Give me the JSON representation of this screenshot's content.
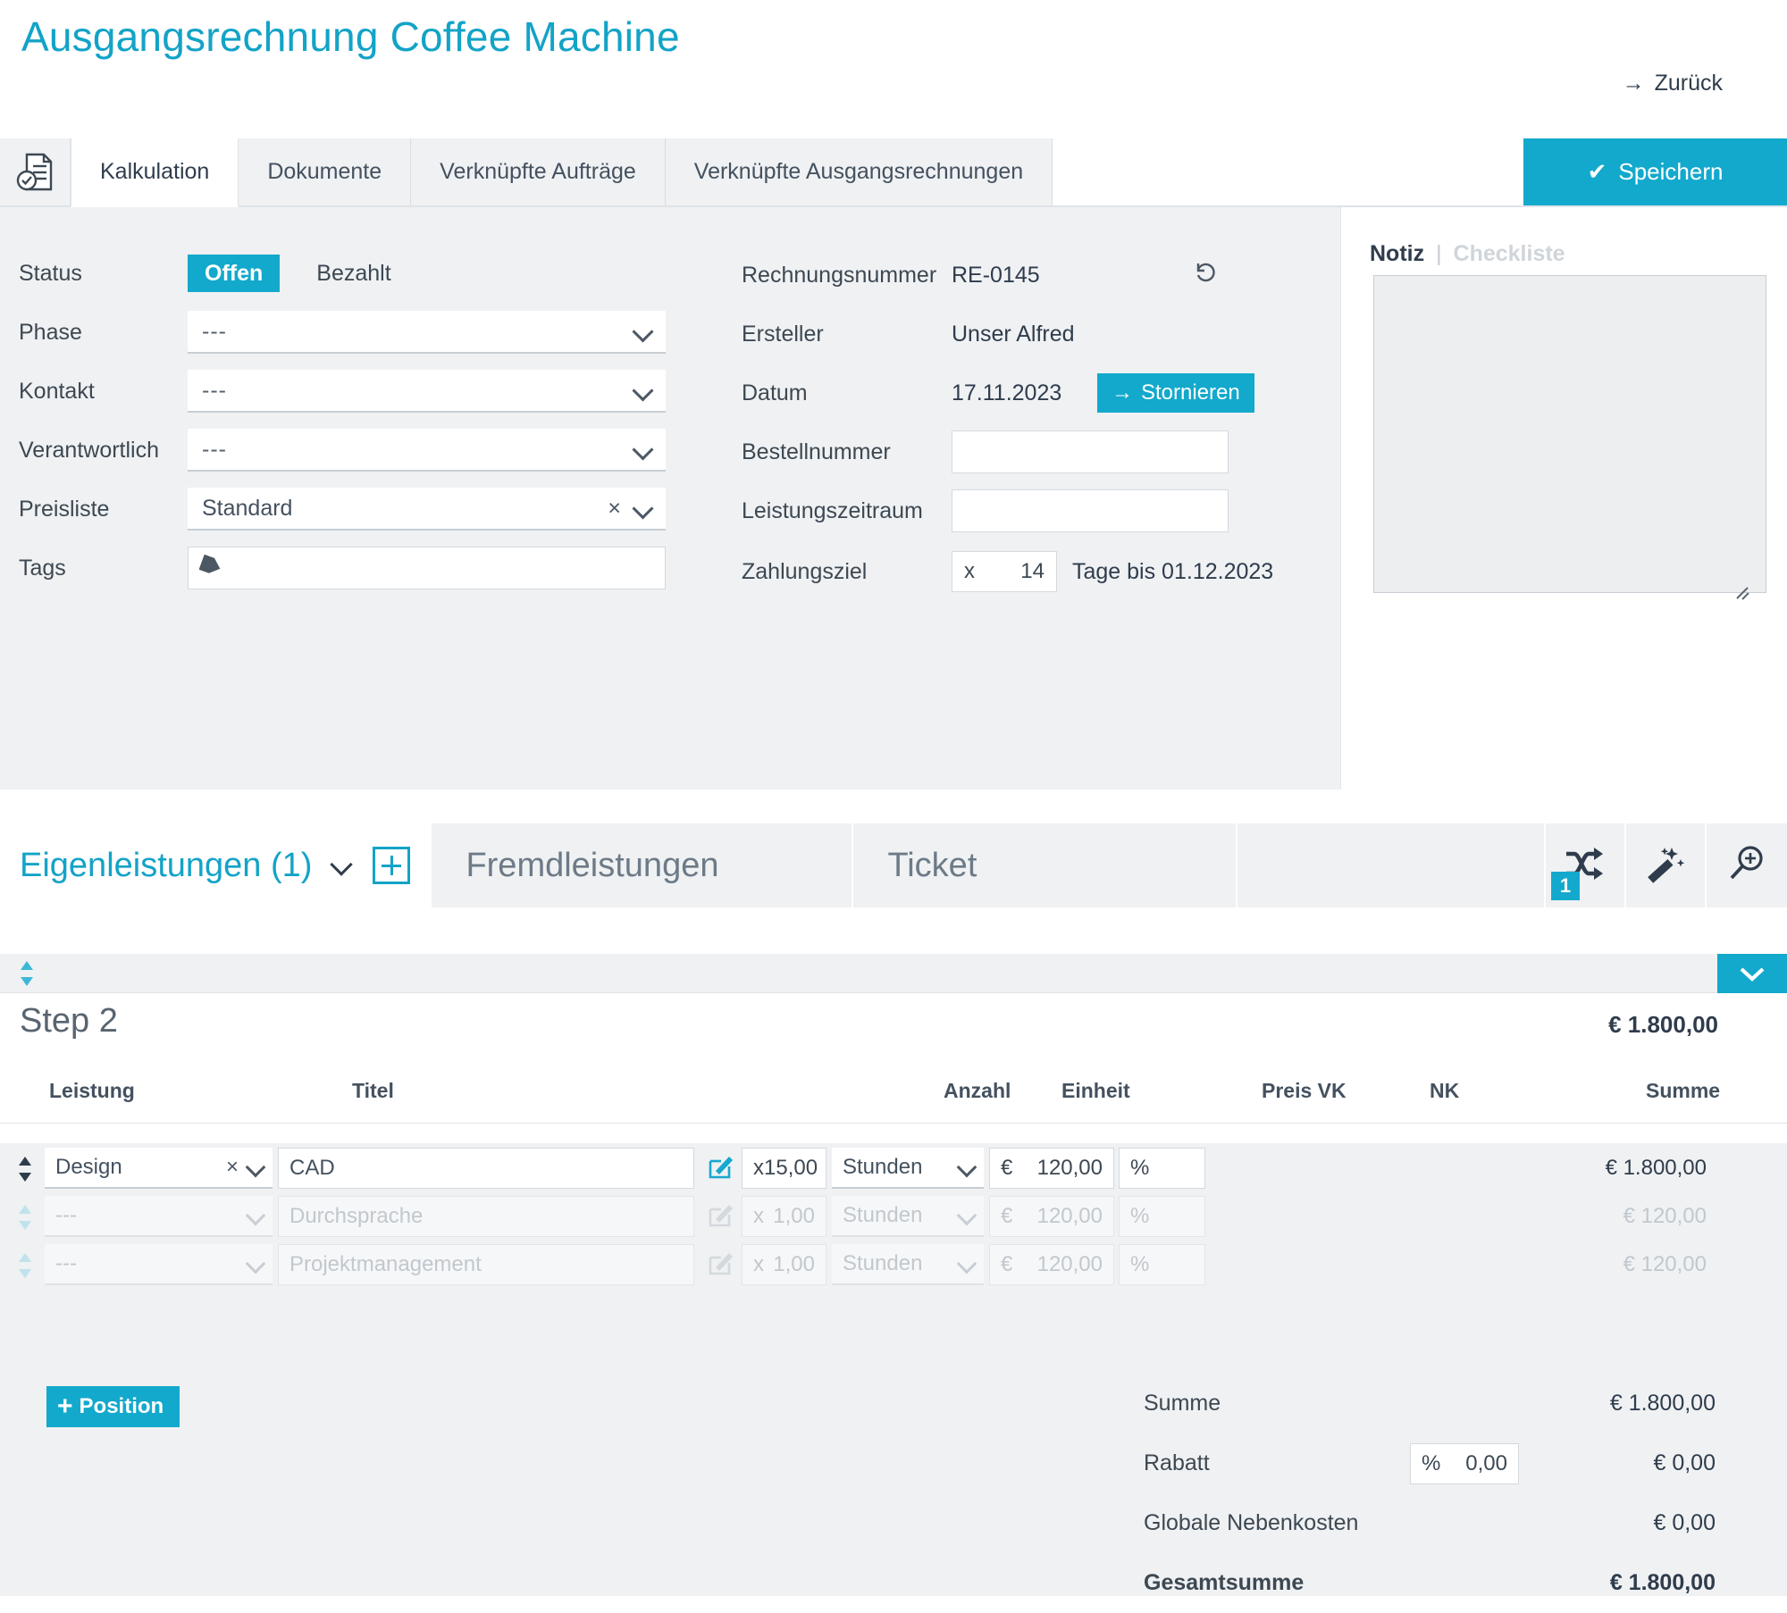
{
  "header": {
    "title": "Ausgangsrechnung Coffee Machine",
    "back_label": "Zurück",
    "back_arrow": "→",
    "save_label": "Speichern",
    "save_check": "✔"
  },
  "tabs": {
    "doc_icon": "document-check-icon",
    "items": [
      {
        "label": "Kalkulation",
        "active": true
      },
      {
        "label": "Dokumente",
        "active": false
      },
      {
        "label": "Verknüpfte Aufträge",
        "active": false
      },
      {
        "label": "Verknüpfte Ausgangsrechnungen",
        "active": false
      }
    ]
  },
  "form": {
    "left": {
      "status_label": "Status",
      "status_open": "Offen",
      "status_paid": "Bezahlt",
      "phase_label": "Phase",
      "phase_value": "---",
      "kontakt_label": "Kontakt",
      "kontakt_value": "---",
      "verantwortlich_label": "Verantwortlich",
      "verantwortlich_value": "---",
      "preisliste_label": "Preisliste",
      "preisliste_value": "Standard",
      "preisliste_clear": "×",
      "tags_label": "Tags",
      "tags_value": "",
      "tag_icon": "tag-icon"
    },
    "right": {
      "rechnungsnummer_label": "Rechnungsnummer",
      "rechnungsnummer_value": "RE-0145",
      "undo_icon": "↺",
      "ersteller_label": "Ersteller",
      "ersteller_value": "Unser Alfred",
      "datum_label": "Datum",
      "datum_value": "17.11.2023",
      "storno_label": "Stornieren",
      "storno_arrow": "→",
      "bestellnummer_label": "Bestellnummer",
      "bestellnummer_value": "",
      "leistungszeitraum_label": "Leistungszeitraum",
      "leistungszeitraum_value": "",
      "zahlungsziel_label": "Zahlungsziel",
      "zahlungsziel_prefix": "x",
      "zahlungsziel_days": "14",
      "zahlungsziel_suffix": "Tage bis 01.12.2023"
    }
  },
  "notiz": {
    "tab_notiz": "Notiz",
    "separator": "|",
    "tab_checkliste": "Checkliste",
    "text": ""
  },
  "section_tabs": {
    "active_label": "Eigenleistungen (1)",
    "add_icon": "plus-box-icon",
    "chevron_icon": "chevron-down-icon",
    "items": [
      {
        "label": "Fremdleistungen"
      },
      {
        "label": "Ticket"
      }
    ],
    "tool_shuffle": "shuffle-icon",
    "tool_shuffle_badge": "1",
    "tool_wand": "magic-wand-icon",
    "tool_zoom": "zoom-in-icon"
  },
  "table": {
    "step_title": "Step 2",
    "step_total": "€ 1.800,00",
    "columns": [
      "Leistung",
      "Titel",
      "Anzahl",
      "Einheit",
      "Preis VK",
      "NK",
      "Summe"
    ],
    "rows": [
      {
        "leistung": "Design",
        "clear": "×",
        "titel": "CAD",
        "edit_icon": "edit-pencil-icon",
        "anzahl_prefix": "x",
        "anzahl": "15,00",
        "einheit": "Stunden",
        "preis_prefix": "€",
        "preis": "120,00",
        "nk_prefix": "%",
        "nk": "",
        "summe": "€ 1.800,00",
        "ghost": false
      },
      {
        "leistung": "---",
        "clear": "",
        "titel": "Durchsprache",
        "edit_icon": "edit-pencil-icon",
        "anzahl_prefix": "x",
        "anzahl": "1,00",
        "einheit": "Stunden",
        "preis_prefix": "€",
        "preis": "120,00",
        "nk_prefix": "%",
        "nk": "",
        "summe": "€ 120,00",
        "ghost": true
      },
      {
        "leistung": "---",
        "clear": "",
        "titel": "Projektmanagement",
        "edit_icon": "edit-pencil-icon",
        "anzahl_prefix": "x",
        "anzahl": "1,00",
        "einheit": "Stunden",
        "preis_prefix": "€",
        "preis": "120,00",
        "nk_prefix": "%",
        "nk": "",
        "summe": "€ 120,00",
        "ghost": true
      }
    ]
  },
  "footer": {
    "add_position_label": "Position",
    "add_position_plus": "+",
    "totals": [
      {
        "label": "Summe",
        "value": "€ 1.800,00",
        "bold": false
      },
      {
        "label": "Rabatt",
        "value": "€ 0,00",
        "bold": false,
        "input_prefix": "%",
        "input_value": "0,00"
      },
      {
        "label": "Globale Nebenkosten",
        "value": "€ 0,00",
        "bold": false
      },
      {
        "label": "Gesamtsumme",
        "value": "€ 1.800,00",
        "bold": true
      }
    ]
  },
  "colors": {
    "accent": "#13a9cc",
    "title": "#13a3c7",
    "panel_bg": "#eff1f3",
    "text": "#3d4852"
  }
}
